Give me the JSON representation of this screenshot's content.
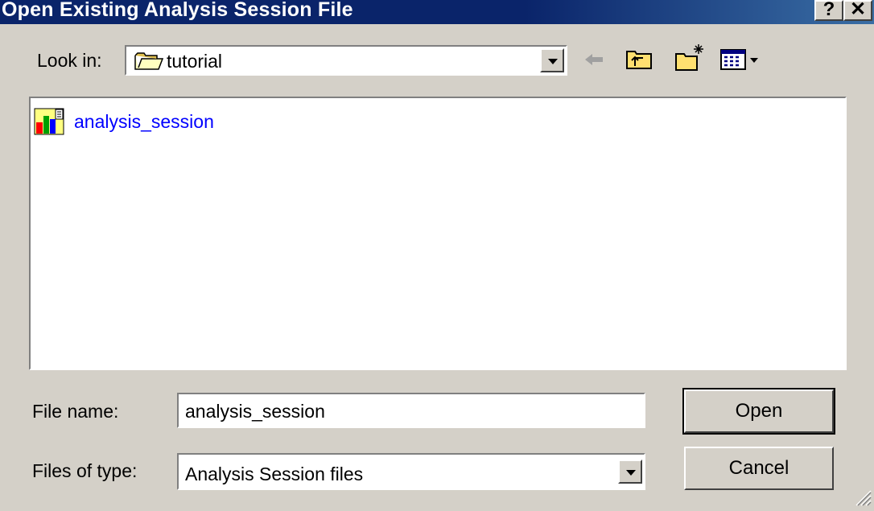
{
  "window": {
    "title": "Open Existing Analysis Session File",
    "help_button": "?",
    "close_button": "✕"
  },
  "look_in": {
    "label": "Look in:",
    "value": "tutorial"
  },
  "toolbar": {
    "icons": [
      "back-arrow-icon",
      "up-folder-icon",
      "new-folder-icon",
      "view-menu-icon"
    ]
  },
  "file_list": {
    "items": [
      {
        "name": "analysis_session",
        "icon": "session-file-icon"
      }
    ]
  },
  "file_name": {
    "label": "File name:",
    "value": "analysis_session"
  },
  "files_of_type": {
    "label": "Files of type:",
    "value": "Analysis Session files"
  },
  "buttons": {
    "open": "Open",
    "cancel": "Cancel"
  },
  "colors": {
    "titlebar": "#0a246a",
    "dialog": "#d4d0c8",
    "link": "#0000ff"
  }
}
